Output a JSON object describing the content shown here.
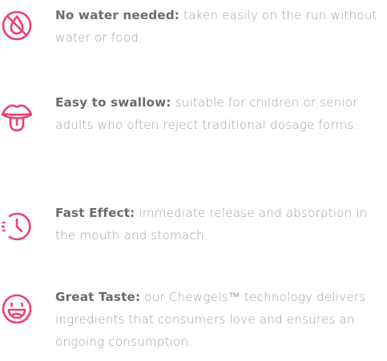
{
  "accent_color": "#ee3f71",
  "features": [
    {
      "icon": "no-water-drop-icon",
      "title": "No water needed:",
      "description": " taken easily on the run without water or food."
    },
    {
      "icon": "mouth-tongue-icon",
      "title": "Easy to swallow:",
      "description": " suitable for children or senior adults who often reject traditional dosage forms."
    },
    {
      "icon": "clock-fast-icon",
      "title": "Fast Effect:",
      "description": " immediate release and absorption in the mouth and stomach."
    },
    {
      "icon": "smiley-tongue-icon",
      "title": "Great Taste:",
      "description": " our Chewgels™ technology delivers ingredients that consumers love and ensures an ongoing consumption."
    }
  ]
}
